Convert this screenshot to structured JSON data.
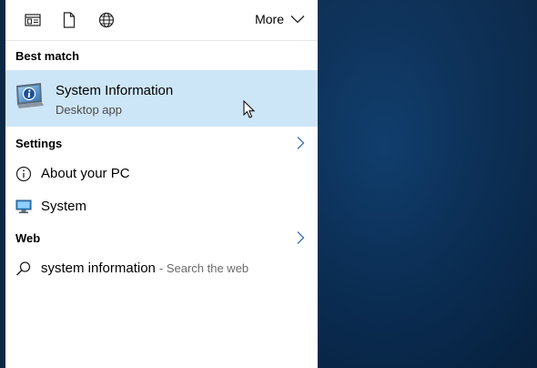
{
  "toolbar": {
    "apps_icon": "apps-filter-icon",
    "documents_icon": "document-icon",
    "web_icon": "globe-icon",
    "more_label": "More"
  },
  "best_match": {
    "header": "Best match",
    "title": "System Information",
    "subtitle": "Desktop app",
    "icon": "system-information-icon"
  },
  "settings": {
    "header": "Settings",
    "items": [
      {
        "label": "About your PC",
        "icon": "info-circle-icon"
      },
      {
        "label": "System",
        "icon": "monitor-icon"
      }
    ]
  },
  "web": {
    "header": "Web",
    "query": "system information",
    "suffix": "- Search the web",
    "icon": "search-icon"
  },
  "colors": {
    "selected_background": "#cde6f7",
    "panel_background": "#ffffff",
    "desktop_background": "#0a2f57"
  }
}
